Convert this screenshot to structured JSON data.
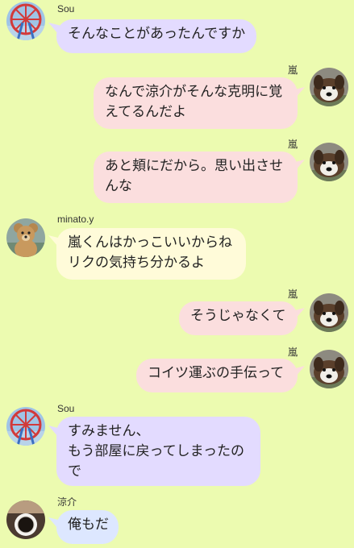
{
  "colors": {
    "background": "#ecfbb0",
    "bubble_sou": "#e3dbff",
    "bubble_arashi": "#fbdede",
    "bubble_minato": "#fffbd9",
    "bubble_ryosuke": "#dde7ff"
  },
  "messages": [
    {
      "sender": "Sou",
      "avatar_icon": "ferris-wheel-avatar-icon",
      "lines": [
        "そんなことがあったんですか"
      ]
    },
    {
      "sender": "嵐",
      "avatar_icon": "dog-avatar-icon",
      "lines": [
        "なんで涼介がそんな克明に覚",
        "えてるんだよ"
      ]
    },
    {
      "sender": "嵐",
      "avatar_icon": "dog-avatar-icon",
      "lines": [
        "あと頬にだから。思い出させ",
        "んな"
      ]
    },
    {
      "sender": "minato.y",
      "avatar_icon": "teddy-bear-avatar-icon",
      "lines": [
        "嵐くんはかっこいいからね",
        "リクの気持ち分かるよ"
      ]
    },
    {
      "sender": "嵐",
      "avatar_icon": "dog-avatar-icon",
      "lines": [
        "そうじゃなくて"
      ]
    },
    {
      "sender": "嵐",
      "avatar_icon": "dog-avatar-icon",
      "lines": [
        "コイツ運ぶの手伝って"
      ]
    },
    {
      "sender": "Sou",
      "avatar_icon": "ferris-wheel-avatar-icon",
      "lines": [
        "すみません、",
        "もう部屋に戻ってしまったの",
        "で"
      ]
    },
    {
      "sender": "涼介",
      "avatar_icon": "coffee-cup-avatar-icon",
      "lines": [
        "俺もだ"
      ]
    }
  ]
}
